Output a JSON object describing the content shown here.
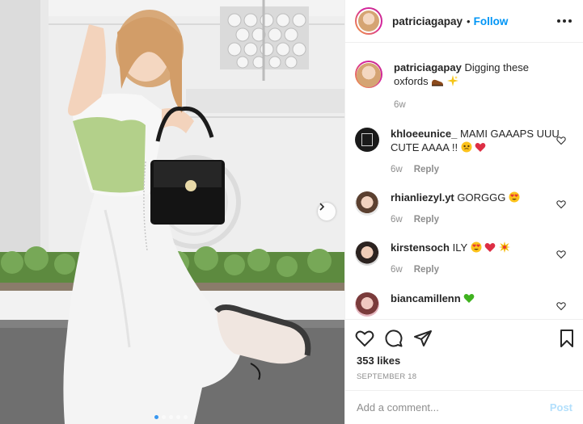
{
  "post": {
    "author": "patriciagapay",
    "follow_label": "Follow",
    "bullet": "•",
    "more_icon": "more-horizontal-icon",
    "likes": "353 likes",
    "date": "September 18",
    "carousel": {
      "slides": 5,
      "active": 1
    }
  },
  "caption": {
    "username": "patriciagapay",
    "text": "Digging these oxfords",
    "age": "6w"
  },
  "comments": [
    {
      "username": "khloeeunice_",
      "text": "MAMI GAAAPS UUU CUTE AAAA !!",
      "age": "6w",
      "reply": "Reply"
    },
    {
      "username": "rhianliezyl.yt",
      "text": "GORGGG",
      "age": "6w",
      "reply": "Reply"
    },
    {
      "username": "kirstensoch",
      "text": "ILY",
      "age": "6w",
      "reply": "Reply"
    },
    {
      "username": "biancamillenn",
      "text": ""
    }
  ],
  "composer": {
    "placeholder": "Add a comment...",
    "post_label": "Post"
  },
  "colors": {
    "link_blue": "#0095f6",
    "post_disabled": "#b2dffc",
    "meta_gray": "#8e8e8e",
    "border": "#efefef"
  }
}
